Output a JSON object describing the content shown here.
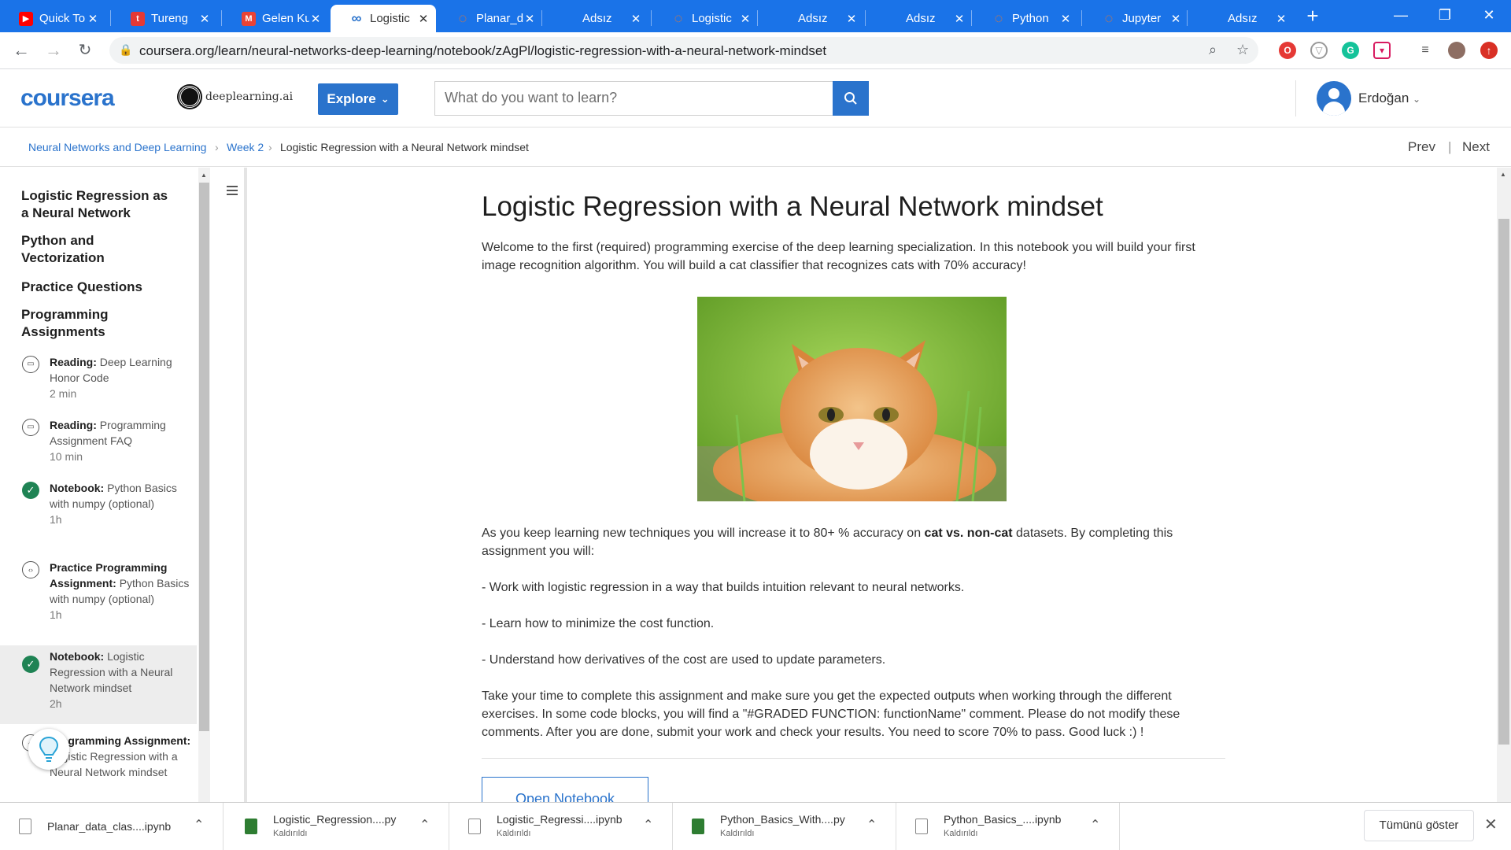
{
  "browser": {
    "tabs": [
      {
        "label": "Quick To",
        "icon": "youtube-icon",
        "icon_color": "#ff0000",
        "icon_glyph": "▶"
      },
      {
        "label": "Tureng",
        "icon": "tureng-icon",
        "icon_color": "#e53935",
        "icon_glyph": "t"
      },
      {
        "label": "Gelen Ku",
        "icon": "gmail-icon",
        "icon_color": "#ea4335",
        "icon_glyph": "M"
      },
      {
        "label": "Logistic",
        "icon": "coursera-icon",
        "icon_color": "#2a73cc",
        "icon_glyph": "∞"
      },
      {
        "label": "Planar_d",
        "icon": "jupyter-icon",
        "icon_color": "#f37726",
        "icon_glyph": "◌"
      },
      {
        "label": "Adsız",
        "icon": "",
        "icon_color": "",
        "icon_glyph": ""
      },
      {
        "label": "Logistic",
        "icon": "jupyter-icon",
        "icon_color": "#f37726",
        "icon_glyph": "◌"
      },
      {
        "label": "Adsız",
        "icon": "",
        "icon_color": "",
        "icon_glyph": ""
      },
      {
        "label": "Adsız",
        "icon": "",
        "icon_color": "",
        "icon_glyph": ""
      },
      {
        "label": "Python",
        "icon": "jupyter-icon",
        "icon_color": "#f37726",
        "icon_glyph": "◌"
      },
      {
        "label": "Jupyter",
        "icon": "jupyter-icon",
        "icon_color": "#f37726",
        "icon_glyph": "◌"
      },
      {
        "label": "Adsız",
        "icon": "",
        "icon_color": "",
        "icon_glyph": ""
      }
    ],
    "active_tab_index": 3,
    "new_tab_label": "+",
    "url": "coursera.org/learn/neural-networks-deep-learning/notebook/zAgPl/logistic-regression-with-a-neural-network-mindset",
    "accent_color": "#1a73e8"
  },
  "header": {
    "logo": "coursera",
    "partner": "deeplearning.ai",
    "explore_label": "Explore",
    "search_placeholder": "What do you want to learn?",
    "user_name": "Erdoğan",
    "brand_color": "#2a73cc"
  },
  "breadcrumb": {
    "items": [
      "Neural Networks and Deep Learning",
      "Week 2",
      "Logistic Regression with a Neural Network mindset"
    ],
    "prev_label": "Prev",
    "next_label": "Next"
  },
  "sidebar": {
    "sections": [
      "Logistic Regression as a Neural Network",
      "Python and Vectorization",
      "Practice Questions",
      "Programming Assignments"
    ],
    "items": [
      {
        "type": "Reading:",
        "title": "Deep Learning Honor Code",
        "duration": "2 min",
        "icon": "reading-icon"
      },
      {
        "type": "Reading:",
        "title": "Programming Assignment FAQ",
        "duration": "10 min",
        "icon": "reading-icon"
      },
      {
        "type": "Notebook:",
        "title": "Python Basics with numpy (optional)",
        "duration": "1h",
        "icon": "completed-check-icon"
      },
      {
        "type": "Practice Programming Assignment:",
        "title": "Python Basics with numpy (optional)",
        "duration": "1h",
        "icon": "code-icon"
      },
      {
        "type": "Notebook:",
        "title": "Logistic Regression with a Neural Network mindset",
        "duration": "2h",
        "icon": "completed-check-icon"
      },
      {
        "type": "Programming Assignment:",
        "title": "Logistic Regression with a Neural Network mindset",
        "duration": "",
        "icon": "code-icon"
      }
    ],
    "completed_color": "#1f8354"
  },
  "content": {
    "title": "Logistic Regression with a Neural Network mindset",
    "intro": "Welcome to the first (required) programming exercise of the deep learning specialization. In this notebook you will build your first image recognition algorithm. You will build a cat classifier that recognizes cats with 70% accuracy!",
    "image_alt": "cat-photo",
    "p2_before": "As you keep learning new techniques you will increase it to 80+ % accuracy on ",
    "p2_bold": "cat vs. non-cat",
    "p2_after": " datasets. By completing this assignment you will:",
    "bullets": [
      "- Work with logistic regression in a way that builds intuition relevant to neural networks.",
      "- Learn how to minimize the cost function.",
      "- Understand how derivatives of the cost are used to update parameters."
    ],
    "closing": "Take your time to complete this assignment and make sure you get the expected outputs when working through the different exercises. In some code blocks, you will find a \"#GRADED FUNCTION: functionName\" comment. Please do not modify these comments. After you are done, submit your work and check your results. You need to score 70% to pass. Good luck :) !",
    "open_notebook_label": "Open Notebook"
  },
  "downloads": {
    "items": [
      {
        "name": "Planar_data_clas....ipynb",
        "status": "",
        "icon": "file-icon"
      },
      {
        "name": "Logistic_Regression....py",
        "status": "Kaldırıldı",
        "icon": "python-file-icon"
      },
      {
        "name": "Logistic_Regressi....ipynb",
        "status": "Kaldırıldı",
        "icon": "file-icon"
      },
      {
        "name": "Python_Basics_With....py",
        "status": "Kaldırıldı",
        "icon": "python-file-icon"
      },
      {
        "name": "Python_Basics_....ipynb",
        "status": "Kaldırıldı",
        "icon": "file-icon"
      }
    ],
    "show_all_label": "Tümünü göster"
  }
}
